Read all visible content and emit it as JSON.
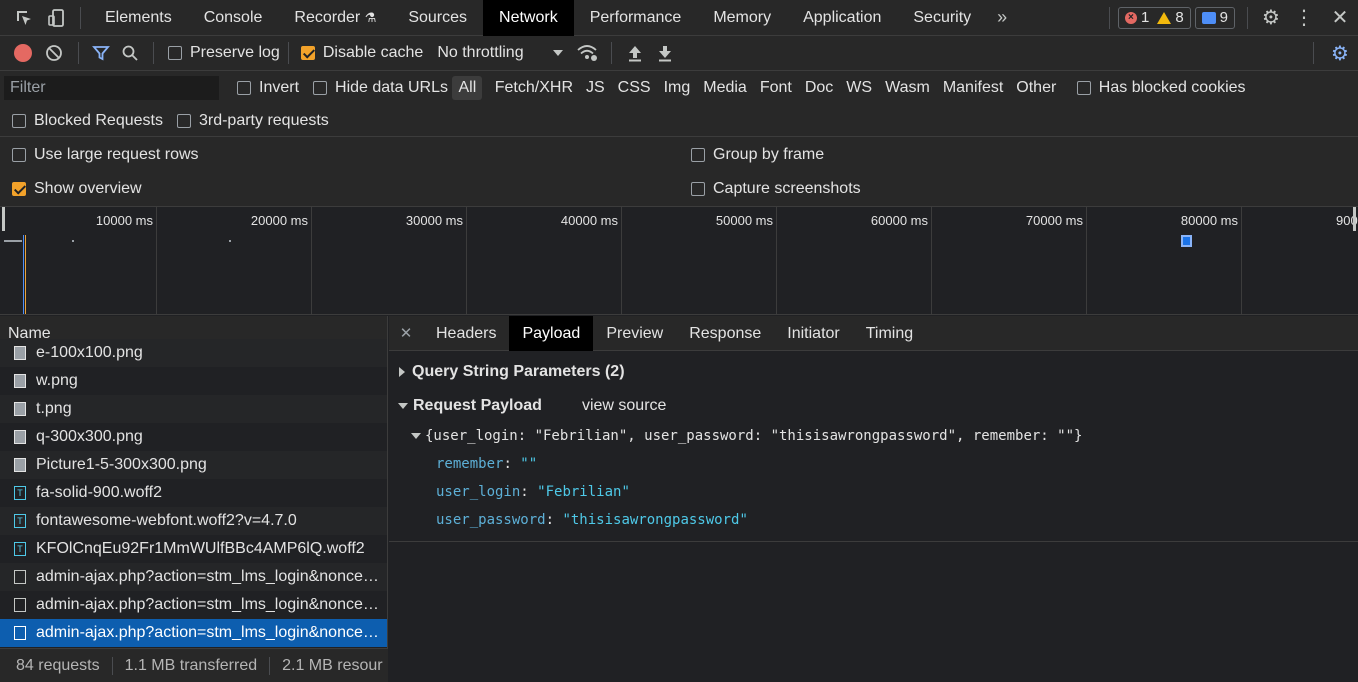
{
  "tabs": [
    "Elements",
    "Console",
    "Recorder",
    "Sources",
    "Network",
    "Performance",
    "Memory",
    "Application",
    "Security"
  ],
  "active_tab": "Network",
  "badges": {
    "errors": "1",
    "warnings": "8",
    "messages": "9"
  },
  "toolbar": {
    "preserve_log": "Preserve log",
    "disable_cache": "Disable cache",
    "throttling": "No throttling"
  },
  "filter": {
    "placeholder": "Filter",
    "invert": "Invert",
    "hide_data_urls": "Hide data URLs",
    "types": [
      "All",
      "Fetch/XHR",
      "JS",
      "CSS",
      "Img",
      "Media",
      "Font",
      "Doc",
      "WS",
      "Wasm",
      "Manifest",
      "Other"
    ],
    "has_blocked_cookies": "Has blocked cookies",
    "blocked_requests": "Blocked Requests",
    "third_party": "3rd-party requests"
  },
  "settings": {
    "large_rows": "Use large request rows",
    "group_by_frame": "Group by frame",
    "show_overview": "Show overview",
    "capture_screenshots": "Capture screenshots"
  },
  "overview": {
    "ticks": [
      "10000 ms",
      "20000 ms",
      "30000 ms",
      "40000 ms",
      "50000 ms",
      "60000 ms",
      "70000 ms",
      "80000 ms",
      "900"
    ]
  },
  "request_list": {
    "header": "Name",
    "items": [
      {
        "name": "e-100x100.png",
        "type": "img"
      },
      {
        "name": "w.png",
        "type": "img"
      },
      {
        "name": "t.png",
        "type": "img"
      },
      {
        "name": "q-300x300.png",
        "type": "img"
      },
      {
        "name": "Picture1-5-300x300.png",
        "type": "img"
      },
      {
        "name": "fa-solid-900.woff2",
        "type": "font"
      },
      {
        "name": "fontawesome-webfont.woff2?v=4.7.0",
        "type": "font"
      },
      {
        "name": "KFOlCnqEu92Fr1MmWUlfBBc4AMP6lQ.woff2",
        "type": "font"
      },
      {
        "name": "admin-ajax.php?action=stm_lms_login&nonce…",
        "type": "doc"
      },
      {
        "name": "admin-ajax.php?action=stm_lms_login&nonce…",
        "type": "doc"
      },
      {
        "name": "admin-ajax.php?action=stm_lms_login&nonce…",
        "type": "doc",
        "selected": true
      }
    ],
    "status": {
      "requests": "84 requests",
      "transferred": "1.1 MB transferred",
      "resources": "2.1 MB resour"
    }
  },
  "detail": {
    "tabs": [
      "Headers",
      "Payload",
      "Preview",
      "Response",
      "Initiator",
      "Timing"
    ],
    "active_tab": "Payload",
    "query_string": "Query String Parameters (2)",
    "request_payload": "Request Payload",
    "view_source": "view source",
    "payload_summary": "{user_login: \"Febrilian\", user_password: \"thisisawrongpassword\", remember: \"\"}",
    "fields": [
      {
        "key": "remember",
        "value": "\"\""
      },
      {
        "key": "user_login",
        "value": "\"Febrilian\""
      },
      {
        "key": "user_password",
        "value": "\"thisisawrongpassword\""
      }
    ]
  }
}
